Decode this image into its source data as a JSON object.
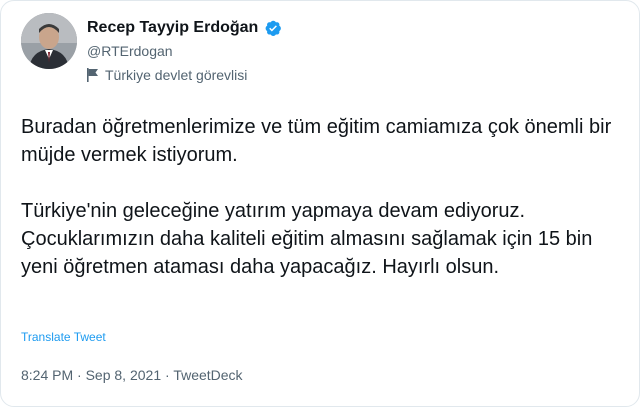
{
  "author": {
    "display_name": "Recep Tayyip Erdoğan",
    "handle": "@RTErdogan",
    "label": "Türkiye devlet görevlisi",
    "avatar_icon": "profile-photo",
    "verified_icon": "verified-badge-icon",
    "label_icon": "flag-icon"
  },
  "tweet": {
    "paragraph_1": "Buradan öğretmenlerimize ve tüm eğitim camiamıza çok önemli bir müjde vermek istiyorum.",
    "paragraph_2": "Türkiye'nin geleceğine yatırım yapmaya devam ediyoruz. Çocuklarımızın daha kaliteli eğitim almasını sağlamak için 15 bin yeni öğretmen ataması daha yapacağız. Hayırlı olsun."
  },
  "translate": {
    "label": "Translate Tweet"
  },
  "meta": {
    "time": "8:24 PM",
    "date": "Sep 8, 2021",
    "source": "TweetDeck",
    "separator": " · "
  },
  "colors": {
    "link": "#1d9bf0",
    "muted": "#536471",
    "text": "#0f1419",
    "verified": "#1d9bf0"
  }
}
